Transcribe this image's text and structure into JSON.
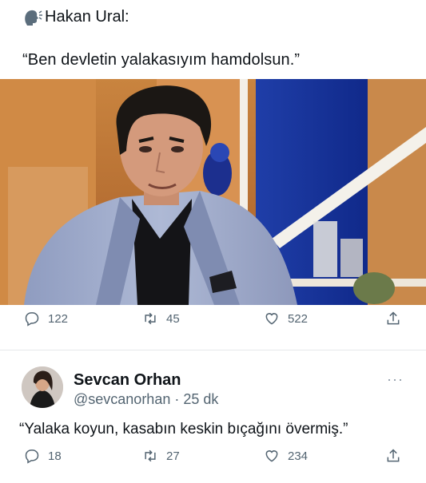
{
  "tweet1": {
    "author_line": "Hakan Ural:",
    "quote": "“Ben devletin yalakasıyım hamdolsun.”",
    "stats": {
      "replies": "122",
      "retweets": "45",
      "likes": "522"
    }
  },
  "tweet2": {
    "name": "Sevcan Orhan",
    "handle": "@sevcanorhan",
    "separator": "·",
    "time": "25 dk",
    "more": "···",
    "text": "“Yalaka koyun, kasabın keskin bıçağını övermiş.”",
    "stats": {
      "replies": "18",
      "retweets": "27",
      "likes": "234"
    }
  },
  "icons": [
    "speaking-head-icon",
    "reply-icon",
    "retweet-icon",
    "like-icon",
    "share-icon",
    "more-icon"
  ],
  "colors": {
    "text": "#0f1419",
    "secondary": "#536471",
    "divider": "#e6e8ea"
  }
}
